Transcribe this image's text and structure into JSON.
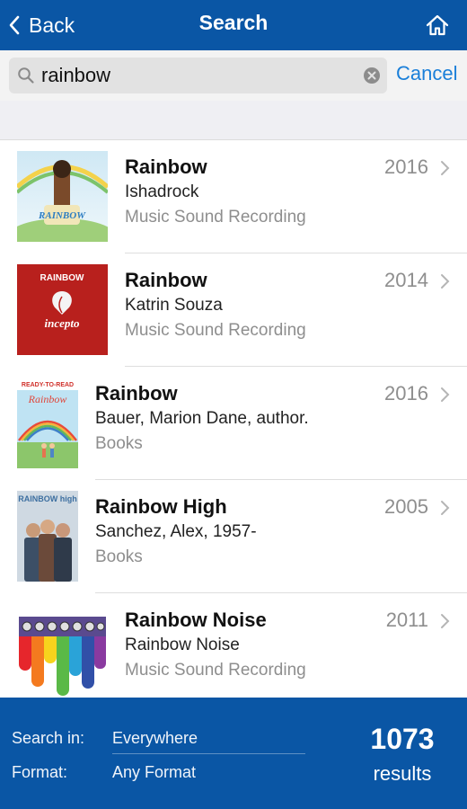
{
  "nav": {
    "back_label": "Back",
    "title": "Search",
    "home_icon": "home-icon"
  },
  "search": {
    "query": "rainbow",
    "placeholder": "",
    "cancel_label": "Cancel"
  },
  "results": [
    {
      "title": "Rainbow",
      "author": "Ishadrock",
      "format": "Music Sound Recording",
      "year": "2016",
      "cover_text": "RAINBOW"
    },
    {
      "title": "Rainbow",
      "author": "Katrin Souza",
      "format": "Music Sound Recording",
      "year": "2014",
      "cover_text": "RAINBOW",
      "cover_brand": "incepto"
    },
    {
      "title": "Rainbow",
      "author": "Bauer, Marion Dane, author.",
      "format": "Books",
      "year": "2016",
      "cover_text": "Rainbow",
      "cover_series": "READY-TO-READ"
    },
    {
      "title": "Rainbow High",
      "author": "Sanchez, Alex, 1957-",
      "format": "Books",
      "year": "2005",
      "cover_text": "RAINBOW high"
    },
    {
      "title": "Rainbow Noise",
      "author": "Rainbow Noise",
      "format": "Music Sound Recording",
      "year": "2011"
    }
  ],
  "filters": {
    "search_in_label": "Search in:",
    "search_in_value": "Everywhere",
    "format_label": "Format:",
    "format_value": "Any Format"
  },
  "summary": {
    "count": "1073",
    "count_label": "results"
  },
  "colors": {
    "brand_blue": "#0a56a5",
    "accent_link": "#1a7fd9",
    "muted_text": "#8e8e8e"
  }
}
